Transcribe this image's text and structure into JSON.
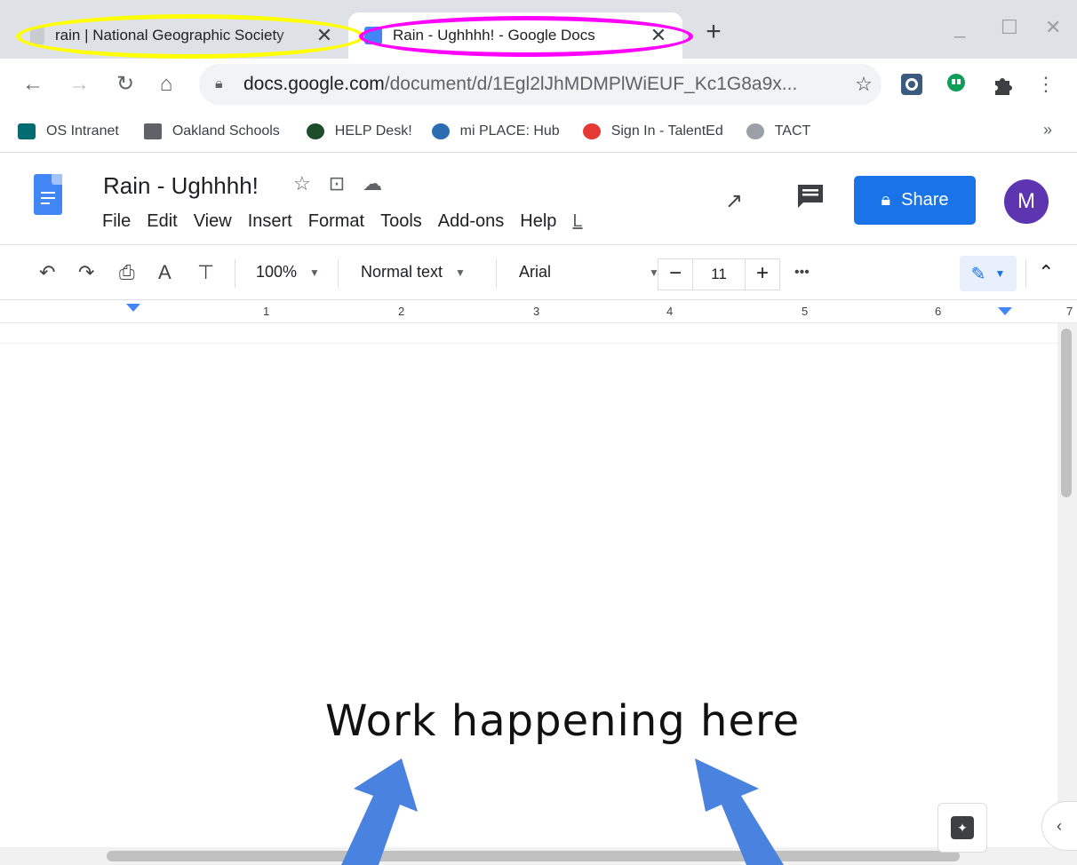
{
  "tabs": [
    {
      "title": "rain | National Geographic Society",
      "active": false
    },
    {
      "title": "Rain - Ughhhh! - Google Docs",
      "active": true
    }
  ],
  "new_tab_label": "+",
  "window_controls": {
    "minimize": "_",
    "maximize": "☐",
    "close": "✕"
  },
  "address": {
    "domain": "docs.google.com",
    "path": "/document/d/1Egl2lJhMDMPlWiEUF_Kc1G8a9x..."
  },
  "bookmarks": [
    {
      "label": "OS Intranet",
      "icon": "sharepoint-icon",
      "color": "#036c70"
    },
    {
      "label": "Oakland Schools",
      "icon": "folder-icon",
      "color": "#5f6368"
    },
    {
      "label": "HELP Desk!",
      "icon": "helpdesk-icon",
      "color": "#1e4d2b"
    },
    {
      "label": "mi PLACE: Hub",
      "icon": "miplace-icon",
      "color": "#2b6cb0"
    },
    {
      "label": "Sign In - TalentEd",
      "icon": "talented-icon",
      "color": "#e53935"
    },
    {
      "label": "TACT",
      "icon": "tact-icon",
      "color": "#9aa0a6"
    }
  ],
  "bookmarks_overflow": "»",
  "doc": {
    "title": "Rain - Ughhhh!",
    "menus": [
      "File",
      "Edit",
      "View",
      "Insert",
      "Format",
      "Tools",
      "Add-ons",
      "Help"
    ],
    "menu_trailing": "L",
    "share_label": "Share",
    "avatar_initial": "M"
  },
  "edit_toolbar": {
    "zoom": "100%",
    "style": "Normal text",
    "font": "Arial",
    "font_size": "11",
    "more": "•••"
  },
  "ruler_numbers": [
    "1",
    "2",
    "3",
    "4",
    "5",
    "6",
    "7"
  ],
  "annotation_text": "Work happening here",
  "colors": {
    "tab_highlight_inactive": "#ffff00",
    "tab_highlight_active": "#ff00ff",
    "arrow": "#4a82e0",
    "share_blue": "#1a73e8",
    "avatar": "#5e35b1"
  }
}
